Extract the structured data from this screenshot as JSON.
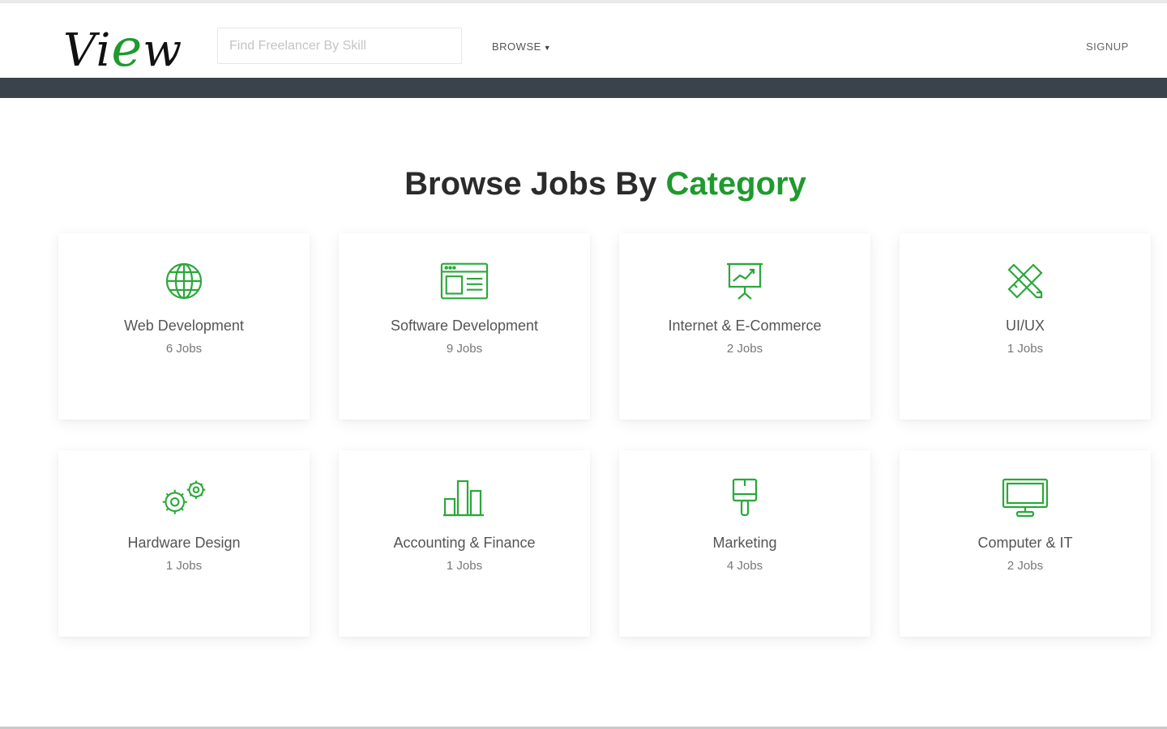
{
  "brand": {
    "logo_v": "Vi",
    "logo_e": "e",
    "logo_w": "w",
    "accent_color": "#1f9a2e"
  },
  "header": {
    "search_placeholder": "Find Freelancer By Skill",
    "browse_label": "BROWSE",
    "signup_label": "SIGNUP"
  },
  "main": {
    "heading_dark": "Browse Jobs By ",
    "heading_accent": "Category",
    "categories": [
      {
        "title": "Web Development",
        "jobs": "6 Jobs",
        "icon": "globe-icon"
      },
      {
        "title": "Software Development",
        "jobs": "9 Jobs",
        "icon": "browser-window-icon"
      },
      {
        "title": "Internet & E-Commerce",
        "jobs": "2 Jobs",
        "icon": "presentation-chart-icon"
      },
      {
        "title": "UI/UX",
        "jobs": "1 Jobs",
        "icon": "design-tools-icon"
      },
      {
        "title": "Hardware Design",
        "jobs": "1 Jobs",
        "icon": "gears-icon"
      },
      {
        "title": "Accounting & Finance",
        "jobs": "1 Jobs",
        "icon": "bar-chart-icon"
      },
      {
        "title": "Marketing",
        "jobs": "4 Jobs",
        "icon": "paint-brush-icon"
      },
      {
        "title": "Computer & IT",
        "jobs": "2 Jobs",
        "icon": "monitor-icon"
      }
    ]
  }
}
